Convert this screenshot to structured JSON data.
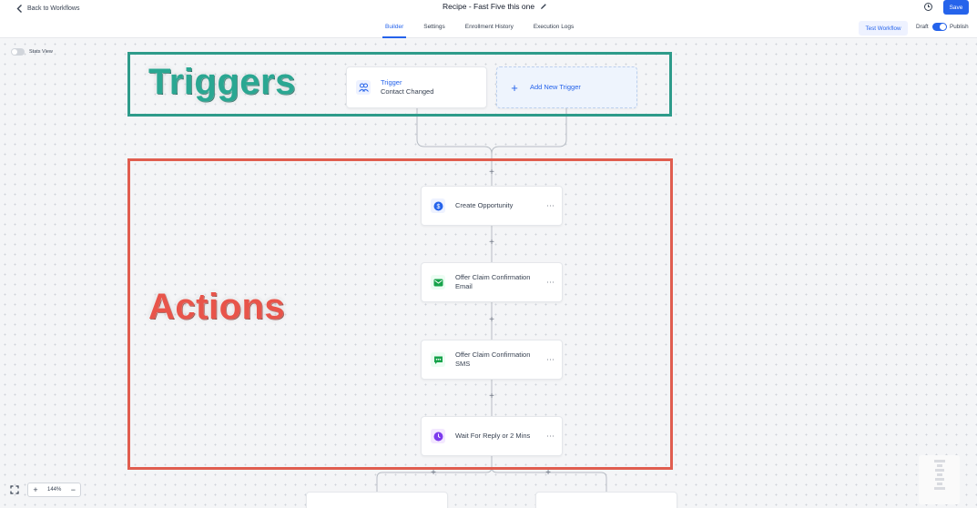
{
  "header": {
    "back_label": "Back to Workflows",
    "title": "Recipe - Fast Five this one",
    "tabs": [
      {
        "label": "Builder",
        "active": true
      },
      {
        "label": "Settings",
        "active": false
      },
      {
        "label": "Enrollment History",
        "active": false
      },
      {
        "label": "Execution Logs",
        "active": false
      }
    ],
    "save_label": "Save",
    "test_label": "Test Workflow",
    "draft_label": "Draft",
    "publish_label": "Publish",
    "publish_on": true
  },
  "canvas": {
    "stats_view_label": "Stats View",
    "triggers_heading": "Triggers",
    "actions_heading": "Actions",
    "trigger": {
      "title": "Trigger",
      "subtitle": "Contact Changed",
      "icon": "contacts-icon"
    },
    "add_trigger_label": "Add New Trigger",
    "actions": [
      {
        "line1": "Create Opportunity",
        "line2": "",
        "icon": "dollar-icon",
        "color": "#2563eb"
      },
      {
        "line1": "Offer Claim Confirmation",
        "line2": "Email",
        "icon": "email-icon",
        "color": "#16a34a"
      },
      {
        "line1": "Offer Claim Confirmation",
        "line2": "SMS",
        "icon": "sms-icon",
        "color": "#16a34a"
      },
      {
        "line1": "Wait For Reply or 2 Mins",
        "line2": "",
        "icon": "clock-icon",
        "color": "#7c3aed"
      }
    ],
    "more_label": "···"
  },
  "zoom": {
    "value": "144%"
  },
  "colors": {
    "accent": "#2563eb",
    "trigger_box": "#2e9b8a",
    "action_box": "#e05d4f"
  }
}
